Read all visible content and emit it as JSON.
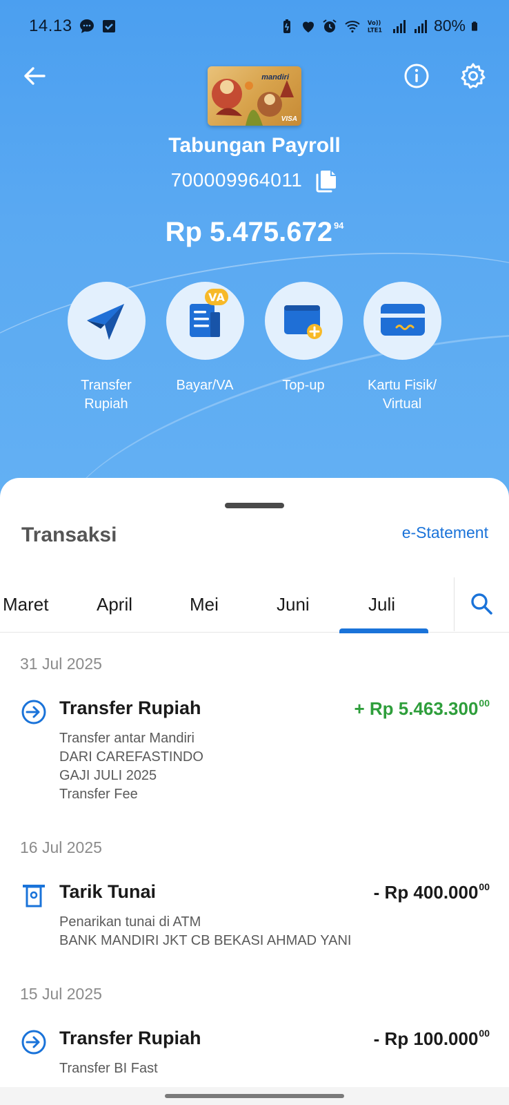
{
  "status_bar": {
    "time": "14.13",
    "battery": "80%"
  },
  "account": {
    "card_brand": "mandiri",
    "card_network": "VISA",
    "name": "Tabungan Payroll",
    "number": "700009964011",
    "balance_main": "Rp 5.475.672",
    "balance_decimal": "94"
  },
  "actions": [
    {
      "label_line1": "Transfer",
      "label_line2": "Rupiah",
      "icon": "paper-plane-icon"
    },
    {
      "label_line1": "Bayar/VA",
      "label_line2": "",
      "badge": "VA",
      "icon": "bill-icon"
    },
    {
      "label_line1": "Top-up",
      "label_line2": "",
      "icon": "wallet-plus-icon"
    },
    {
      "label_line1": "Kartu Fisik/",
      "label_line2": "Virtual",
      "icon": "card-icon"
    }
  ],
  "sheet": {
    "title": "Transaksi",
    "estatement": "e-Statement",
    "months": [
      "Maret",
      "April",
      "Mei",
      "Juni",
      "Juli"
    ],
    "selected_month": "Juli"
  },
  "transactions": [
    {
      "date": "31 Jul 2025",
      "title": "Transfer Rupiah",
      "amount": "+ Rp 5.463.300",
      "decimal": "00",
      "lines": [
        "Transfer antar Mandiri",
        "DARI CAREFASTINDO",
        "GAJI JULI 2025",
        "Transfer Fee"
      ]
    },
    {
      "date": "16 Jul 2025",
      "title": "Tarik Tunai",
      "amount": "- Rp 400.000",
      "decimal": "00",
      "lines": [
        "Penarikan tunai di ATM",
        "BANK MANDIRI JKT CB BEKASI AHMAD YANI"
      ]
    },
    {
      "date": "15 Jul 2025",
      "title": "Transfer Rupiah",
      "amount": "- Rp 100.000",
      "decimal": "00",
      "lines": [
        "Transfer BI Fast"
      ]
    }
  ],
  "colors": {
    "accent": "#1a73d9",
    "positive": "#2e9e3b",
    "hero": "#5aa9f2"
  }
}
